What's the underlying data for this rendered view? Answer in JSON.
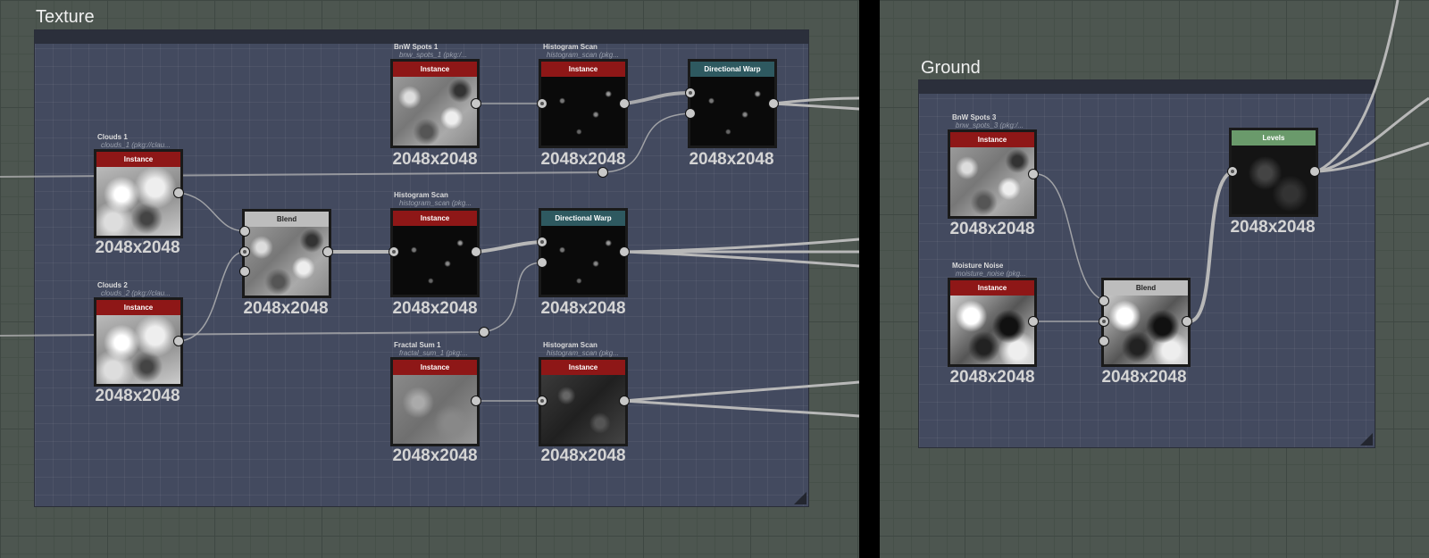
{
  "frames": {
    "texture": {
      "title": "Texture"
    },
    "ground": {
      "title": "Ground"
    }
  },
  "nodes": {
    "bnw_spots_1": {
      "title": "BnW Spots 1",
      "subtitle": "bnw_spots_1 (pkg:/...",
      "header": "Instance",
      "resolution": "2048x2048"
    },
    "histogram_scan_top": {
      "title": "Histogram Scan",
      "subtitle": "histogram_scan (pkg...",
      "header": "Instance",
      "resolution": "2048x2048"
    },
    "directional_warp_top": {
      "header": "Directional Warp",
      "resolution": "2048x2048"
    },
    "clouds_1": {
      "title": "Clouds 1",
      "subtitle": "clouds_1 (pkg://clau...",
      "header": "Instance",
      "resolution": "2048x2048"
    },
    "blend_mid": {
      "header": "Blend",
      "resolution": "2048x2048"
    },
    "histogram_scan_mid": {
      "title": "Histogram Scan",
      "subtitle": "histogram_scan (pkg...",
      "header": "Instance",
      "resolution": "2048x2048"
    },
    "directional_warp_mid": {
      "header": "Directional Warp",
      "resolution": "2048x2048"
    },
    "clouds_2": {
      "title": "Clouds 2",
      "subtitle": "clouds_2 (pkg://clau...",
      "header": "Instance",
      "resolution": "2048x2048"
    },
    "fractal_sum_1": {
      "title": "Fractal Sum 1",
      "subtitle": "fractal_sum_1 (pkg:...",
      "header": "Instance",
      "resolution": "2048x2048"
    },
    "histogram_scan_bot": {
      "title": "Histogram Scan",
      "subtitle": "histogram_scan (pkg...",
      "header": "Instance",
      "resolution": "2048x2048"
    },
    "bnw_spots_3": {
      "title": "BnW Spots 3",
      "subtitle": "bnw_spots_3 (pkg:/...",
      "header": "Instance",
      "resolution": "2048x2048"
    },
    "moisture_noise": {
      "title": "Moisture Noise",
      "subtitle": "moisture_noise (pkg...",
      "header": "Instance",
      "resolution": "2048x2048"
    },
    "blend_ground": {
      "header": "Blend",
      "resolution": "2048x2048"
    },
    "levels": {
      "header": "Levels",
      "resolution": "2048x2048"
    }
  },
  "colors": {
    "instance_header": "#8e1717",
    "warp_header": "#2e5960",
    "blend_header": "#bdbdbd",
    "levels_header": "#6a9a6b",
    "frame_bg": "#434a5f",
    "canvas_bg": "#4d5650"
  }
}
